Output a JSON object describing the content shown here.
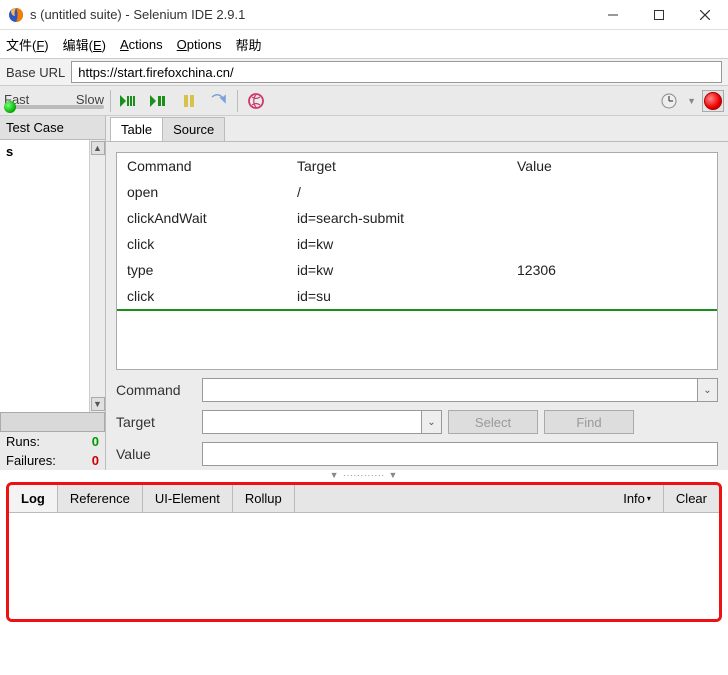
{
  "title": "s (untitled suite) - Selenium IDE 2.9.1",
  "menus": {
    "file": "文件(F)",
    "edit": "编辑(E)",
    "actions": "Actions",
    "options": "Options",
    "help": "帮助"
  },
  "url": {
    "label": "Base URL",
    "value": "https://start.firefoxchina.cn/"
  },
  "speed": {
    "fast": "Fast",
    "slow": "Slow"
  },
  "left": {
    "header": "Test Case",
    "item": "s",
    "runs_label": "Runs:",
    "runs_value": "0",
    "fail_label": "Failures:",
    "fail_value": "0"
  },
  "tabs": {
    "table": "Table",
    "source": "Source"
  },
  "grid": {
    "head": {
      "command": "Command",
      "target": "Target",
      "value": "Value"
    },
    "rows": [
      {
        "command": "open",
        "target": "/",
        "value": ""
      },
      {
        "command": "clickAndWait",
        "target": "id=search-submit",
        "value": ""
      },
      {
        "command": "click",
        "target": "id=kw",
        "value": ""
      },
      {
        "command": "type",
        "target": "id=kw",
        "value": "12306"
      },
      {
        "command": "click",
        "target": "id=su",
        "value": ""
      }
    ]
  },
  "form": {
    "command_label": "Command",
    "target_label": "Target",
    "value_label": "Value",
    "select_btn": "Select",
    "find_btn": "Find"
  },
  "log": {
    "tabs": {
      "log": "Log",
      "reference": "Reference",
      "uielement": "UI-Element",
      "rollup": "Rollup"
    },
    "info": "Info",
    "clear": "Clear"
  }
}
